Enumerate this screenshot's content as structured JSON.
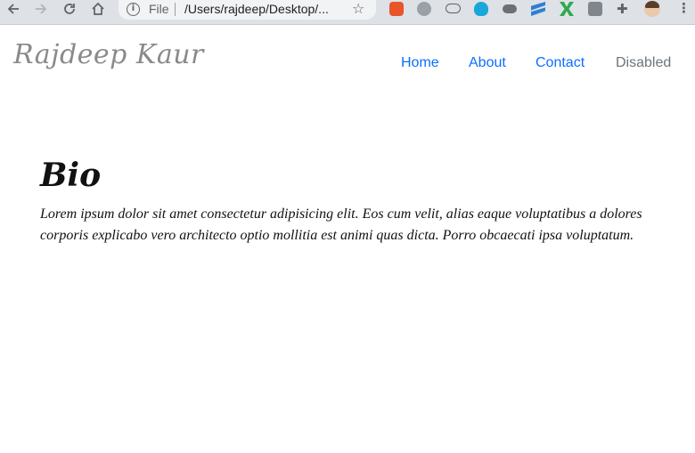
{
  "browser": {
    "omnibox": {
      "scheme_label": "File",
      "url": "/Users/rajdeep/Desktop/..."
    },
    "icons": [
      "back-icon",
      "forward-icon",
      "reload-icon",
      "home-icon",
      "info-icon",
      "star-icon",
      "extension-icon",
      "puzzle-icon",
      "avatar",
      "menu-icon"
    ]
  },
  "navbar": {
    "brand": "Rajdeep Kaur",
    "links": [
      {
        "label": "Home"
      },
      {
        "label": "About"
      },
      {
        "label": "Contact"
      },
      {
        "label": "Disabled"
      }
    ],
    "link_color": "#0d6efd",
    "disabled_color": "#6c757d"
  },
  "main": {
    "heading": "Bio",
    "paragraph": "Lorem ipsum dolor sit amet consectetur adipisicing elit. Eos cum velit, alias eaque voluptatibus a dolores corporis explicabo vero architecto optio mollitia est animi quas dicta. Porro obcaecati ipsa voluptatum."
  }
}
